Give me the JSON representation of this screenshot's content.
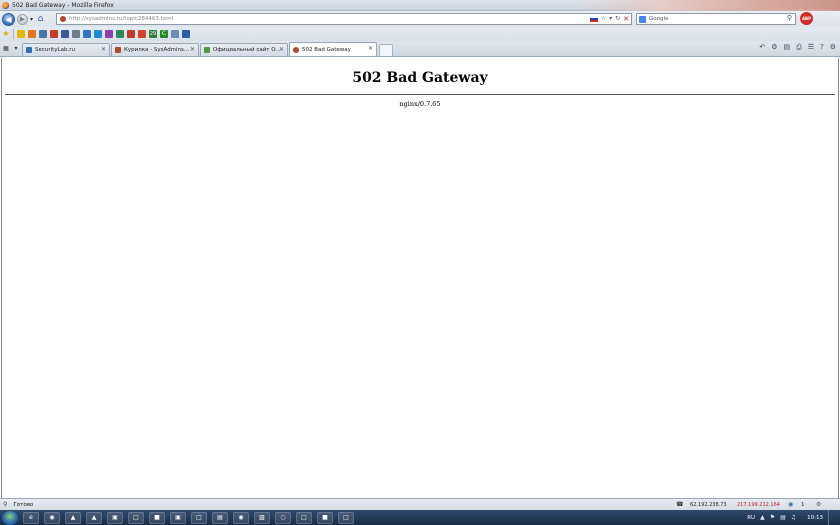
{
  "window": {
    "title": "502 Bad Gateway - Mozilla Firefox"
  },
  "navigation": {
    "url_host": "http://sysadmins.ru",
    "url_path": "/topic284463.html",
    "search_engine": "Google",
    "addon_badge": "ABP"
  },
  "bookmarks": {
    "items": [
      {
        "icon": "star-icon"
      },
      {
        "icon": "rss-icon"
      },
      {
        "icon": "vk-icon"
      },
      {
        "icon": "ok-icon"
      },
      {
        "icon": "number-29-icon",
        "label": "29"
      },
      {
        "icon": "c-icon",
        "label": "C"
      }
    ]
  },
  "tabs": [
    {
      "label": "SecurityLab.ru",
      "active": false
    },
    {
      "label": "Курилка - SysAdmins...",
      "active": false
    },
    {
      "label": "Официальный сайт О...",
      "active": false
    },
    {
      "label": "502 Bad Gateway",
      "active": true
    }
  ],
  "page": {
    "heading": "502 Bad Gateway",
    "server": "nginx/0.7.65"
  },
  "statusbar": {
    "status": "Готово",
    "ip_local": "62.192.238.73",
    "ip_remote": "217.199.212.164",
    "count": "1"
  },
  "taskbar": {
    "lang": "RU",
    "clock": "10:13"
  },
  "colors": {
    "accent": "#2f6cb5",
    "ip_remote": "#c8141b",
    "taskbar": "#1a2c46"
  }
}
